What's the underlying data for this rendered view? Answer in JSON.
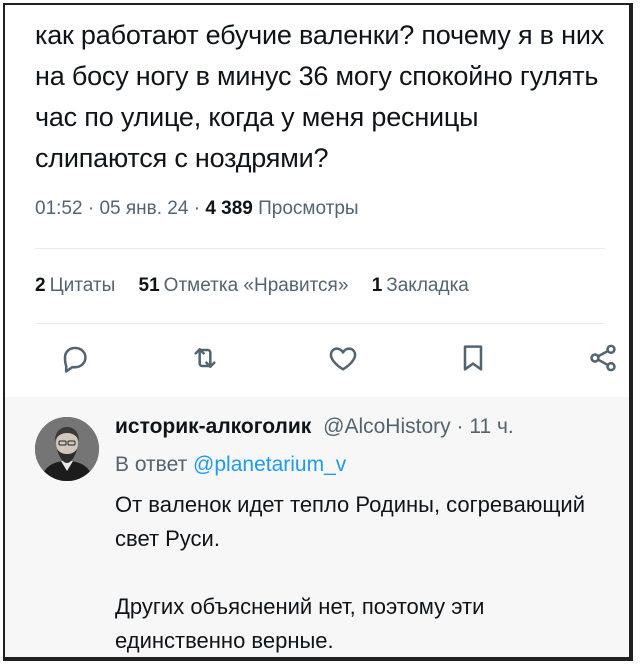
{
  "tweet": {
    "text": "как работают ебучие валенки? почему я в них на босу ногу в минус 36 могу спокойно гулять час по улице, когда у меня ресницы слипаются с ноздрями?",
    "time": "01:52",
    "sep1": "·",
    "date": "05 янв. 24",
    "sep2": "·",
    "views_count": "4 389",
    "views_label": "Просмотры"
  },
  "stats": {
    "quotes_count": "2",
    "quotes_label": "Цитаты",
    "likes_count": "51",
    "likes_label": "Отметка «Нравится»",
    "bookmarks_count": "1",
    "bookmarks_label": "Закладка"
  },
  "actions": {
    "icons": [
      "reply-icon",
      "retweet-icon",
      "like-icon",
      "bookmark-icon",
      "share-icon"
    ],
    "icon_color": "#536471"
  },
  "reply": {
    "author_name": "историк-алкоголик",
    "author_handle": "@AlcoHistory",
    "sep": "·",
    "time": "11 ч.",
    "reply_to_prefix": "В ответ",
    "reply_to_handle": "@planetarium_v",
    "paragraph1": "От валенок идет тепло Родины, согревающий свет Руси.",
    "paragraph2": "Других объяснений нет, поэтому эти единственно верные."
  },
  "colors": {
    "text": "#0f1419",
    "muted": "#536471",
    "link": "#1d9bf0",
    "divider": "#e6ecf0",
    "reply_background": "#f7f7f7"
  }
}
